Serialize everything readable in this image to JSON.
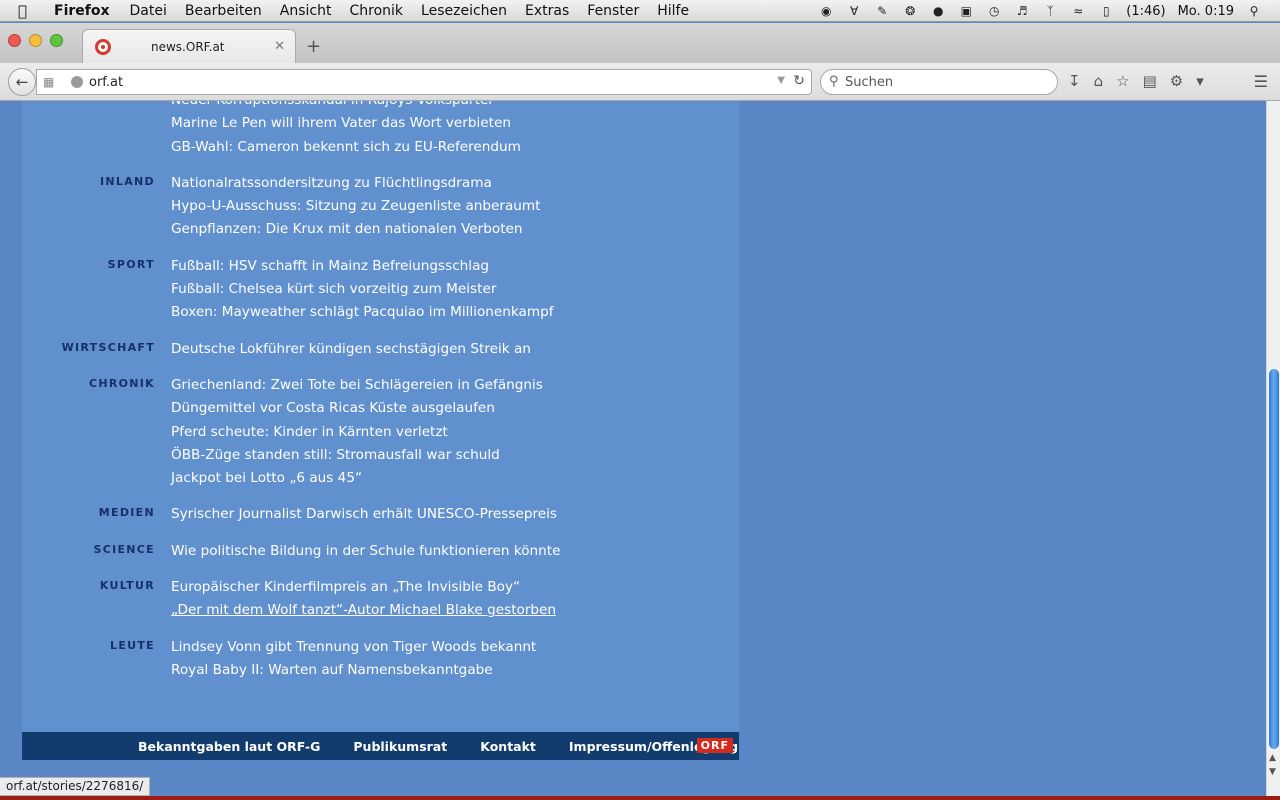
{
  "menubar": {
    "app": "Firefox",
    "items": [
      "Datei",
      "Bearbeiten",
      "Ansicht",
      "Chronik",
      "Lesezeichen",
      "Extras",
      "Fenster",
      "Hilfe"
    ],
    "battery": "(1:46)",
    "clock": "Mo. 0:19"
  },
  "tab": {
    "title": "news.ORF.at"
  },
  "urlbar": {
    "url": "orf.at"
  },
  "search": {
    "placeholder": "Suchen"
  },
  "sections": [
    {
      "category": "",
      "headlines": [
        "Neuer Korruptionsskandal in Rajoys Volkspartei",
        "Marine Le Pen will ihrem Vater das Wort verbieten",
        "GB-Wahl: Cameron bekennt sich zu EU-Referendum"
      ]
    },
    {
      "category": "INLAND",
      "headlines": [
        "Nationalratssondersitzung zu Flüchtlingsdrama",
        "Hypo-U-Ausschuss: Sitzung zu Zeugenliste anberaumt",
        "Genpflanzen: Die Krux mit den nationalen Verboten"
      ]
    },
    {
      "category": "SPORT",
      "headlines": [
        "Fußball: HSV schafft in Mainz Befreiungsschlag",
        "Fußball: Chelsea kürt sich vorzeitig zum Meister",
        "Boxen: Mayweather schlägt Pacquiao im Millionenkampf"
      ]
    },
    {
      "category": "WIRTSCHAFT",
      "headlines": [
        "Deutsche Lokführer kündigen sechstägigen Streik an"
      ]
    },
    {
      "category": "CHRONIK",
      "headlines": [
        "Griechenland: Zwei Tote bei Schlägereien in Gefängnis",
        "Düngemittel vor Costa Ricas Küste ausgelaufen",
        "Pferd scheute: Kinder in Kärnten verletzt",
        "ÖBB-Züge standen still: Stromausfall war schuld",
        "Jackpot bei Lotto „6 aus 45“"
      ]
    },
    {
      "category": "MEDIEN",
      "headlines": [
        "Syrischer Journalist Darwisch erhält UNESCO-Pressepreis"
      ]
    },
    {
      "category": "SCIENCE",
      "headlines": [
        "Wie politische Bildung in der Schule funktionieren könnte"
      ]
    },
    {
      "category": "KULTUR",
      "headlines": [
        "Europäischer Kinderfilmpreis an „The Invisible Boy“",
        "„Der mit dem Wolf tanzt“-Autor Michael Blake gestorben"
      ]
    },
    {
      "category": "LEUTE",
      "headlines": [
        "Lindsey Vonn gibt Trennung von Tiger Woods bekannt",
        "Royal Baby II: Warten auf Namensbekanntgabe"
      ]
    }
  ],
  "footer": {
    "links": [
      "Bekanntgaben laut ORF-G",
      "Publikumsrat",
      "Kontakt",
      "Impressum/Offenlegung"
    ],
    "logo": "ORF"
  },
  "status": {
    "url": "orf.at/stories/2276816/"
  }
}
